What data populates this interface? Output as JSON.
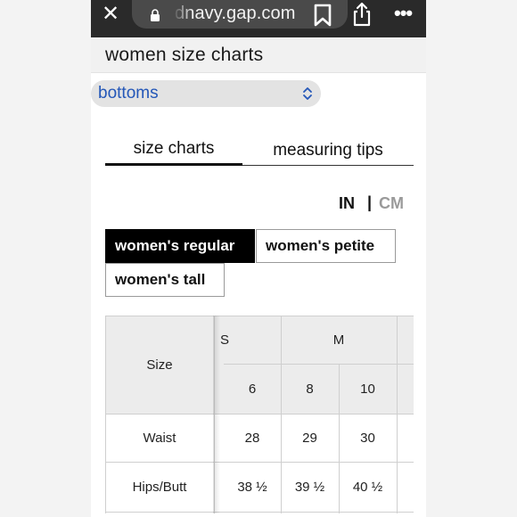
{
  "browser": {
    "url": "dnavy.gap.com",
    "close_glyph": "✕",
    "more_glyph": "•••"
  },
  "page": {
    "title": "women size charts"
  },
  "category": {
    "selected": "bottoms"
  },
  "tabs": [
    {
      "label": "size charts",
      "active": true
    },
    {
      "label": "measuring tips",
      "active": false
    }
  ],
  "units": {
    "in": "IN",
    "separator": "|",
    "cm": "CM",
    "active": "IN"
  },
  "fits": [
    {
      "label": "women's regular",
      "active": true
    },
    {
      "label": "women's petite",
      "active": false
    },
    {
      "label": "women's tall",
      "active": false
    }
  ],
  "size_table": {
    "row_header": "Size",
    "size_groups": [
      "S",
      "M"
    ],
    "numeric_sizes": [
      "6",
      "8",
      "10"
    ],
    "rows": [
      {
        "label": "Waist",
        "values": [
          "28",
          "29",
          "30"
        ]
      },
      {
        "label": "Hips/Butt",
        "values": [
          "38 ½",
          "39 ½",
          "40 ½"
        ]
      }
    ]
  },
  "colors": {
    "link_blue": "#2457b8",
    "active_fit_bg": "#000000",
    "inactive_unit": "#9a9a9a",
    "browser_bar": "#2a2a2a"
  }
}
